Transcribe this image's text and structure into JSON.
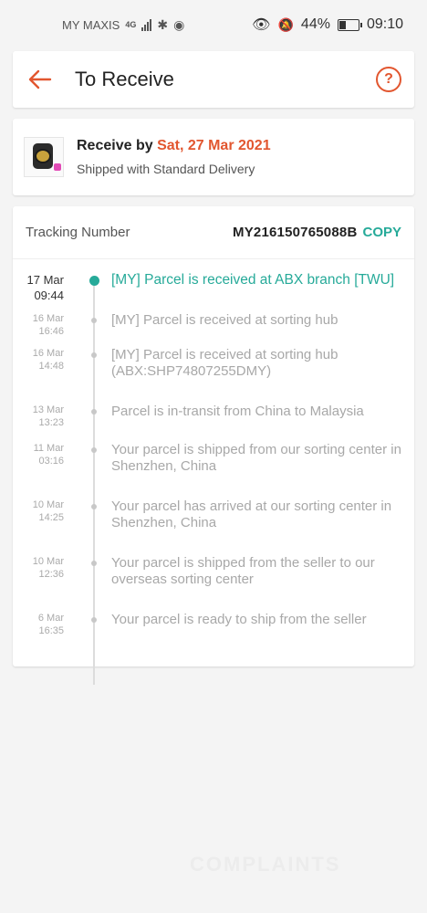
{
  "status_bar": {
    "carrier": "MY MAXIS",
    "network": "4G",
    "battery": "44%",
    "battery_level": 0.44,
    "time": "09:10"
  },
  "header": {
    "title": "To Receive",
    "help_symbol": "?"
  },
  "receive": {
    "prefix": "Receive by ",
    "date": "Sat, 27 Mar 2021",
    "shipping": "Shipped with Standard Delivery"
  },
  "tracking": {
    "label": "Tracking Number",
    "number": "MY216150765088B",
    "copy_label": "COPY",
    "events": [
      {
        "date": "17 Mar",
        "time": "09:44",
        "text": "[MY] Parcel is received at ABX branch [TWU]",
        "active": true
      },
      {
        "date": "16 Mar",
        "time": "16:46",
        "text": "[MY] Parcel is received at sorting hub"
      },
      {
        "date": "16 Mar",
        "time": "14:48",
        "text": "[MY] Parcel is received at sorting hub (ABX:SHP74807255DMY)"
      },
      {
        "date": "13 Mar",
        "time": "13:23",
        "text": "Parcel is in-transit from China to Malaysia"
      },
      {
        "date": "11 Mar",
        "time": "03:16",
        "text": "Your parcel is shipped from our sorting center in Shenzhen, China"
      },
      {
        "date": "10 Mar",
        "time": "14:25",
        "text": "Your parcel has arrived at our sorting center in Shenzhen, China"
      },
      {
        "date": "10 Mar",
        "time": "12:36",
        "text": "Your parcel is shipped from the seller to our overseas sorting center"
      },
      {
        "date": "6 Mar",
        "time": "16:35",
        "text": "Your parcel is ready to ship from the seller"
      }
    ]
  },
  "colors": {
    "accent": "#e2562f",
    "teal": "#26aa99"
  },
  "watermark": "COMPLAINTS"
}
